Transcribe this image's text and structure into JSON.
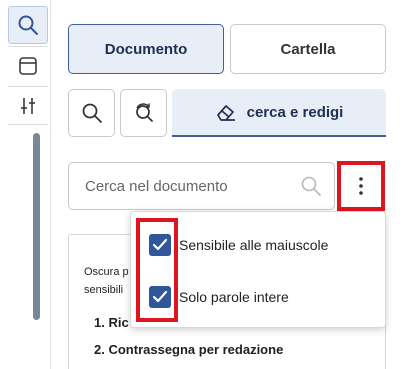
{
  "toolbar": {
    "items": [
      {
        "icon": "search-icon",
        "active": true
      },
      {
        "icon": "panel-icon",
        "active": false
      },
      {
        "icon": "sliders-icon",
        "active": false
      }
    ]
  },
  "scope": {
    "document_label": "Documento",
    "folder_label": "Cartella",
    "selected": "Documento"
  },
  "modes": {
    "redact_label": "cerca e redigi",
    "selected": "cerca e redigi"
  },
  "search": {
    "placeholder": "Cerca nel documento",
    "value": ""
  },
  "menu": {
    "items": [
      {
        "label": "Sensibile alle maiuscole",
        "checked": true
      },
      {
        "label": "Solo parole intere",
        "checked": true
      }
    ]
  },
  "instructions": {
    "line1": "Oscura p",
    "line2": "sensibili",
    "steps": [
      {
        "number": "1.",
        "text": "Ric"
      },
      {
        "number": "2.",
        "text": "Contrassegna per redazione"
      }
    ]
  },
  "colors": {
    "accent": "#3f5f9c",
    "accent_bg": "#e8eef8",
    "checkbox": "#2f5699",
    "highlight": "#e0141e"
  }
}
